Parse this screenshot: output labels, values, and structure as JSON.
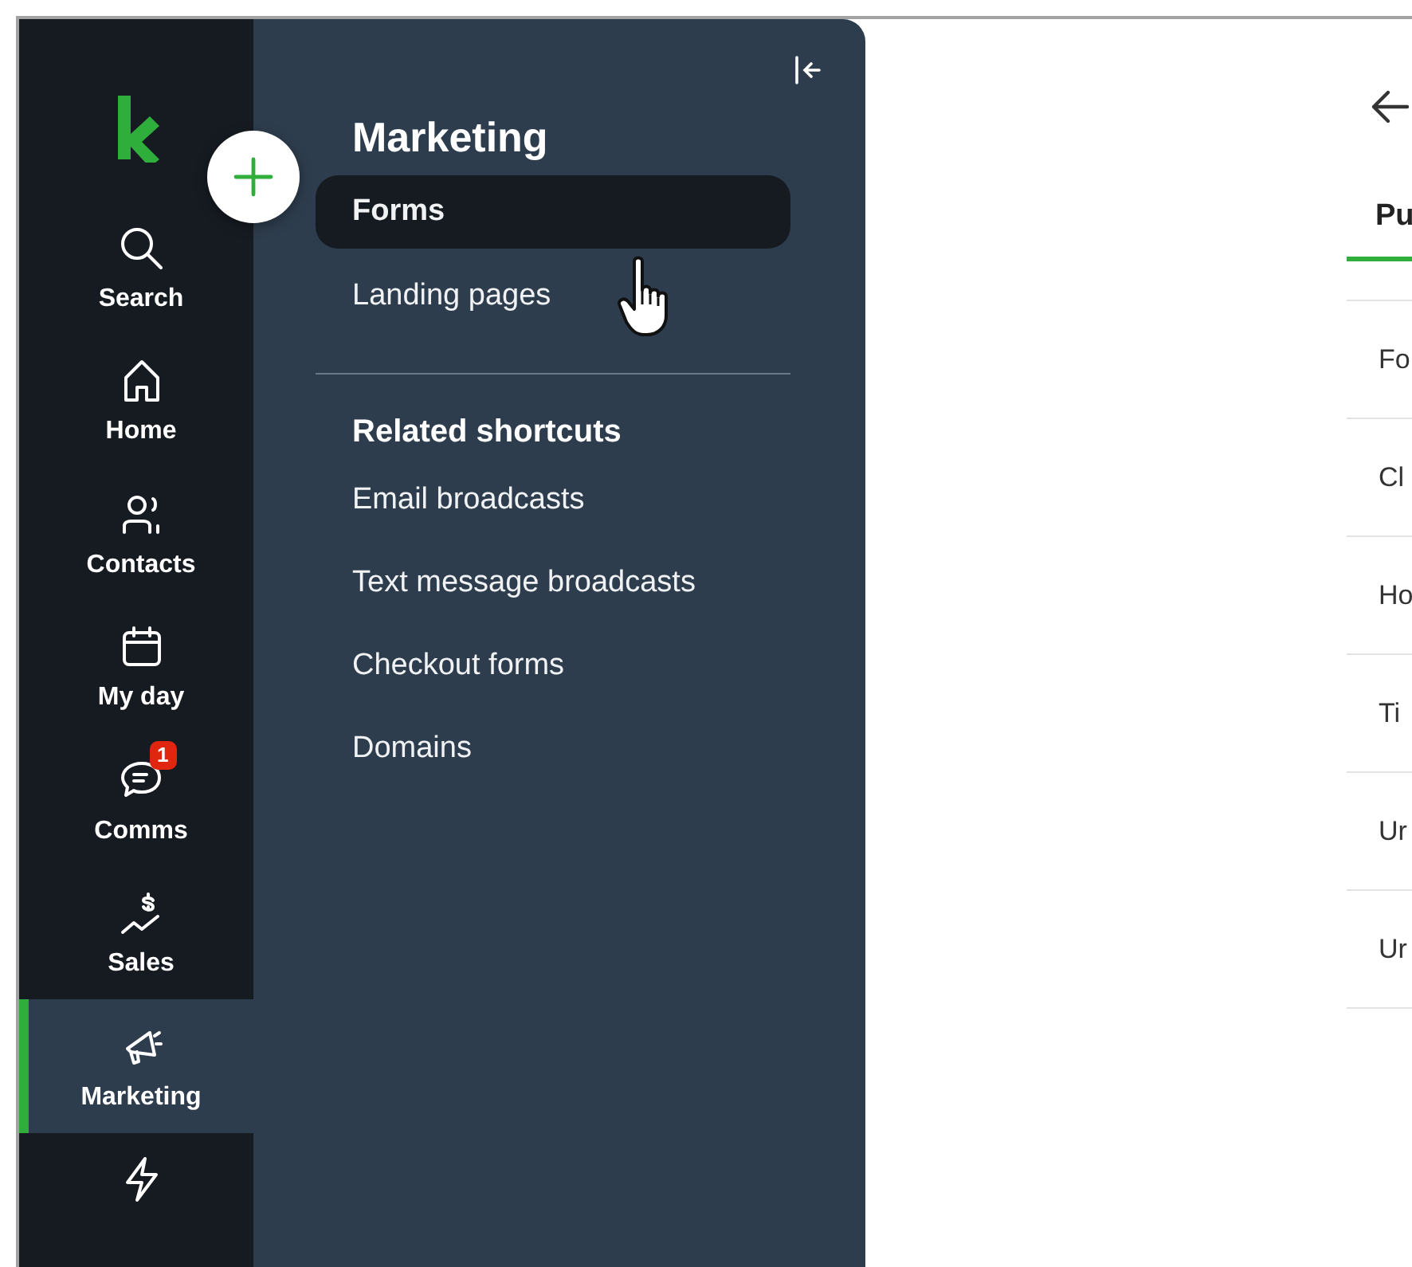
{
  "rail": {
    "items": [
      {
        "label": "Search",
        "selected": false
      },
      {
        "label": "Home",
        "selected": false
      },
      {
        "label": "Contacts",
        "selected": false
      },
      {
        "label": "My day",
        "selected": false
      },
      {
        "label": "Comms",
        "selected": false,
        "badge": "1"
      },
      {
        "label": "Sales",
        "selected": false
      },
      {
        "label": "Marketing",
        "selected": true
      },
      {
        "selected": false
      }
    ]
  },
  "flyout": {
    "title": "Marketing",
    "items": [
      {
        "label": "Forms",
        "selected": true
      },
      {
        "label": "Landing pages",
        "selected": false
      }
    ],
    "shortcuts_heading": "Related shortcuts",
    "shortcuts": [
      "Email broadcasts",
      "Text message broadcasts",
      "Checkout forms",
      "Domains"
    ]
  },
  "main": {
    "tabs": [
      {
        "label": "Pu",
        "selected": true
      }
    ],
    "rows": [
      "Fo",
      "Cl",
      "Ho",
      "Ti",
      "Ur",
      "Ur"
    ]
  }
}
